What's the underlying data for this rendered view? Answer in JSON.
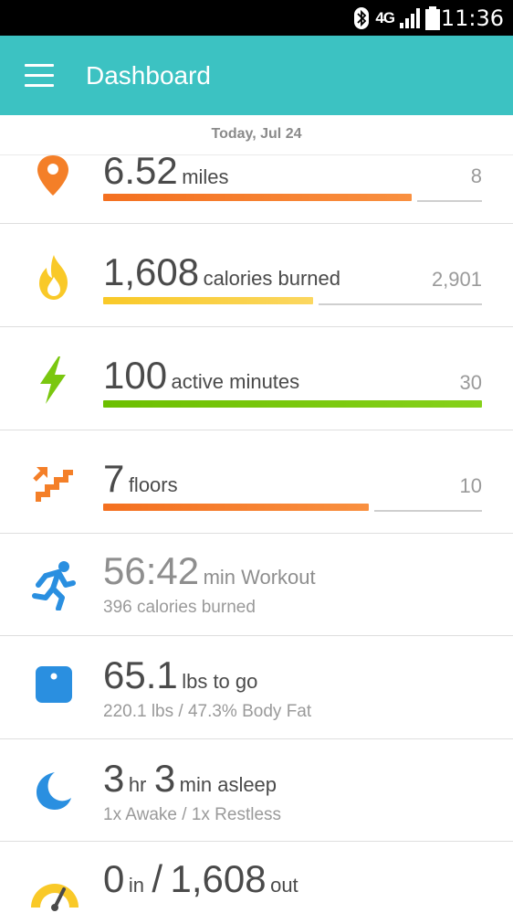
{
  "status_bar": {
    "network": "4G",
    "time": "11:36"
  },
  "app_bar": {
    "title": "Dashboard"
  },
  "date_label": "Today, Jul 24",
  "tiles": {
    "distance": {
      "value": "6.52",
      "unit": "miles",
      "goal": "8",
      "progress": 0.815,
      "color": "#f47f28"
    },
    "calories": {
      "value": "1,608",
      "unit": "calories burned",
      "goal": "2,901",
      "progress": 0.554,
      "color": "#f9c928"
    },
    "active": {
      "value": "100",
      "unit": "active minutes",
      "goal": "30",
      "progress": 1.0,
      "color": "#7ac70f"
    },
    "floors": {
      "value": "7",
      "unit": "floors",
      "goal": "10",
      "progress": 0.7,
      "color": "#f47f28"
    },
    "workout": {
      "value": "56:42",
      "unit": "min Workout",
      "sub": "396 calories burned"
    },
    "weight": {
      "value": "65.1",
      "unit": "lbs to go",
      "sub": "220.1 lbs / 47.3% Body Fat"
    },
    "sleep": {
      "hours": "3",
      "hours_unit": "hr",
      "minutes": "3",
      "minutes_unit": "min asleep",
      "sub": "1x Awake / 1x Restless"
    },
    "food": {
      "in_value": "0",
      "in_unit": "in",
      "separator": "/",
      "out_value": "1,608",
      "out_unit": "out"
    }
  },
  "icons": {
    "distance": "location-pin-icon",
    "calories": "flame-icon",
    "active": "lightning-bolt-icon",
    "floors": "stairs-icon",
    "workout": "running-person-icon",
    "weight": "scale-icon",
    "sleep": "crescent-moon-icon",
    "food": "gauge-icon"
  }
}
